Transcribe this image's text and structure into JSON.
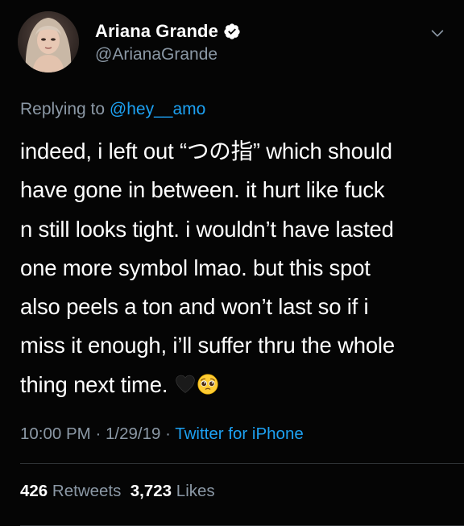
{
  "author": {
    "display_name": "Ariana Grande",
    "handle": "@ArianaGrande",
    "verified_icon": "verified-badge-icon",
    "avatar_icon": "avatar"
  },
  "reply": {
    "prefix": "Replying to ",
    "mention": "@hey__amo"
  },
  "tweet": {
    "lines": [
      "indeed, i left out “つの指” which should",
      "have gone in between. it hurt like fuck",
      "n still looks tight. i wouldn’t have lasted",
      "one more symbol lmao. but this spot",
      "also peels a ton and won’t last so if i",
      "miss it enough, i’ll suffer thru the whole",
      "thing next time. "
    ],
    "emojis": [
      "black-heart-icon",
      "pleading-face-icon"
    ]
  },
  "meta": {
    "time": "10:00 PM",
    "sep1": " · ",
    "date": "1/29/19",
    "sep2": " · ",
    "source": "Twitter for iPhone"
  },
  "stats": {
    "retweets_count": "426",
    "retweets_label": " Retweets",
    "likes_count": "3,723",
    "likes_label": " Likes"
  },
  "colors": {
    "background": "#050505",
    "text": "#ffffff",
    "secondary": "#8b98a5",
    "link": "#1da1f2"
  }
}
